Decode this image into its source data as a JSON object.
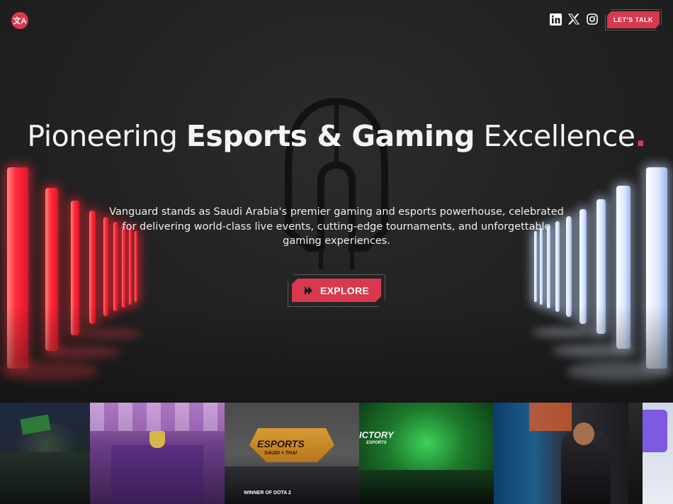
{
  "header": {
    "language_icon": "translate-icon",
    "language_label": "文A",
    "socials": [
      {
        "name": "linkedin-icon"
      },
      {
        "name": "x-twitter-icon"
      },
      {
        "name": "instagram-icon"
      }
    ],
    "cta_label": "LET'S TALK"
  },
  "hero": {
    "headline_light_1": "Pioneering ",
    "headline_bold": "Esports & Gaming",
    "headline_light_2": " Excellence",
    "headline_dot": ".",
    "description": "Vanguard stands as Saudi Arabia's premier gaming and esports powerhouse, celebrated for delivering world-class live events, cutting-edge tournaments, and unforgettable gaming experiences.",
    "explore_label": "EXPLORE",
    "explore_icon": "double-chevron-right-icon"
  },
  "gallery": {
    "photo3_logo": "ESPORTS",
    "photo3_sub": "SAUDI × THAI",
    "photo3_caption": "WINNER OF DOTA 2",
    "photo4_logo": "ICTORY",
    "photo4_sub": "ESPORTS"
  },
  "colors": {
    "accent": "#d8394e",
    "background": "#1f1f1f"
  }
}
